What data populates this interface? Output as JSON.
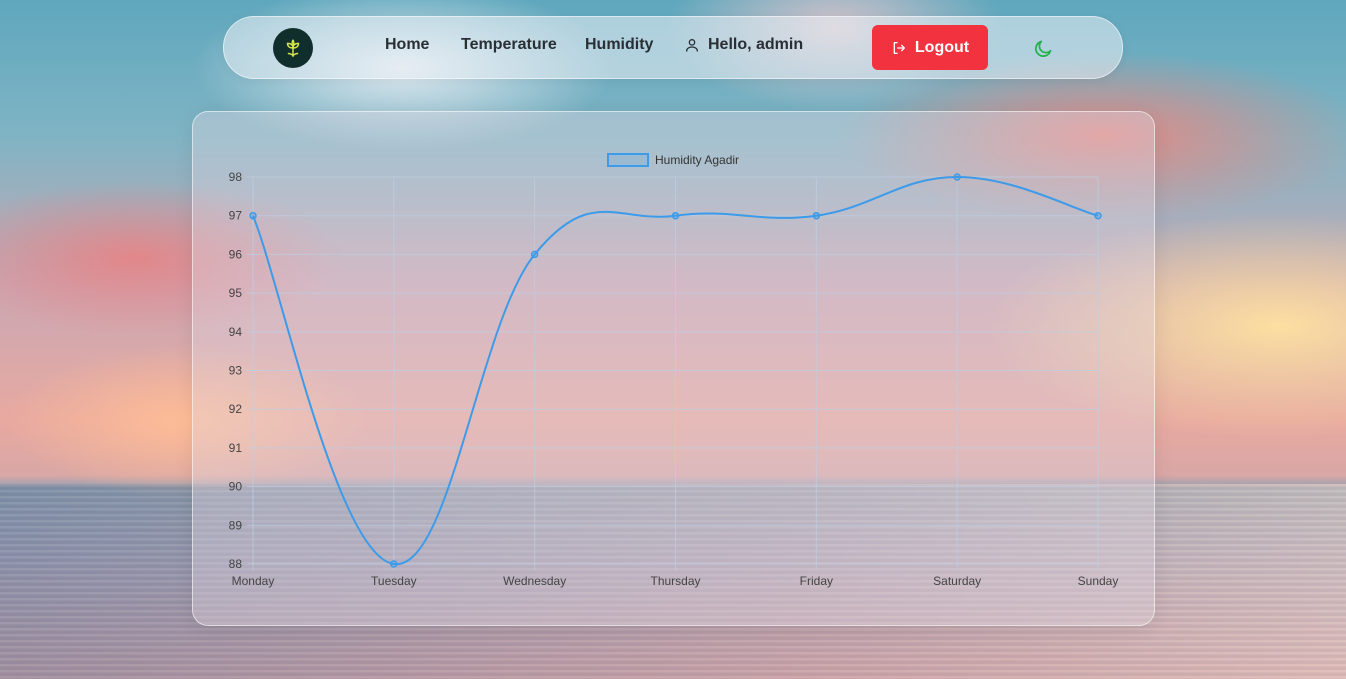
{
  "nav": {
    "links": [
      "Home",
      "Temperature",
      "Humidity"
    ],
    "greeting": "Hello, admin",
    "logout_label": "Logout",
    "logo_icon": "plant-icon",
    "theme_icon": "moon-icon",
    "logout_color": "#f2333f",
    "accent_color": "#22b14c"
  },
  "chart_data": {
    "type": "line",
    "categories": [
      "Monday",
      "Tuesday",
      "Wednesday",
      "Thursday",
      "Friday",
      "Saturday",
      "Sunday"
    ],
    "series": [
      {
        "name": "Humidity Agadir",
        "values": [
          97,
          88,
          96,
          97,
          97,
          98,
          97
        ],
        "color": "#3d9be9"
      }
    ],
    "ylim": [
      88,
      98
    ],
    "yticks": [
      98,
      97,
      96,
      95,
      94,
      93,
      92,
      91,
      90,
      89,
      88
    ],
    "grid": true,
    "legend": "top-center",
    "smooth": true
  }
}
